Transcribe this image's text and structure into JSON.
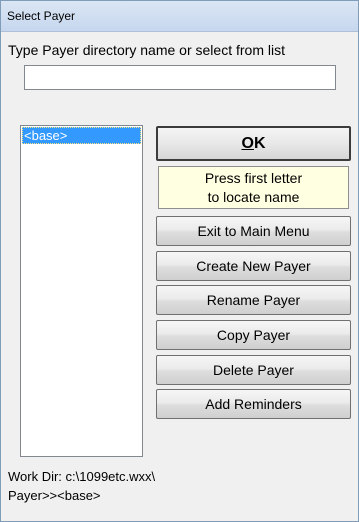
{
  "window": {
    "title": "Select Payer"
  },
  "prompt": {
    "label": "Type Payer directory name or select from list",
    "input_value": ""
  },
  "payer_list": {
    "items": [
      "<base>"
    ],
    "selected_index": 0
  },
  "buttons": {
    "ok": {
      "accel": "O",
      "rest": "K"
    },
    "exit": "Exit to Main Menu",
    "create": "Create New Payer",
    "rename": "Rename Payer",
    "copy": "Copy Payer",
    "delete": "Delete Payer",
    "reminders": "Add Reminders"
  },
  "hint": {
    "line1": "Press first letter",
    "line2": "to locate name"
  },
  "footer": {
    "work_dir": "Work Dir: c:\\1099etc.wxx\\",
    "payer": "Payer>><base>"
  },
  "colors": {
    "selection": "#3399ff",
    "hint_background": "#ffffe1",
    "title_bar": "#c6d7ee"
  }
}
